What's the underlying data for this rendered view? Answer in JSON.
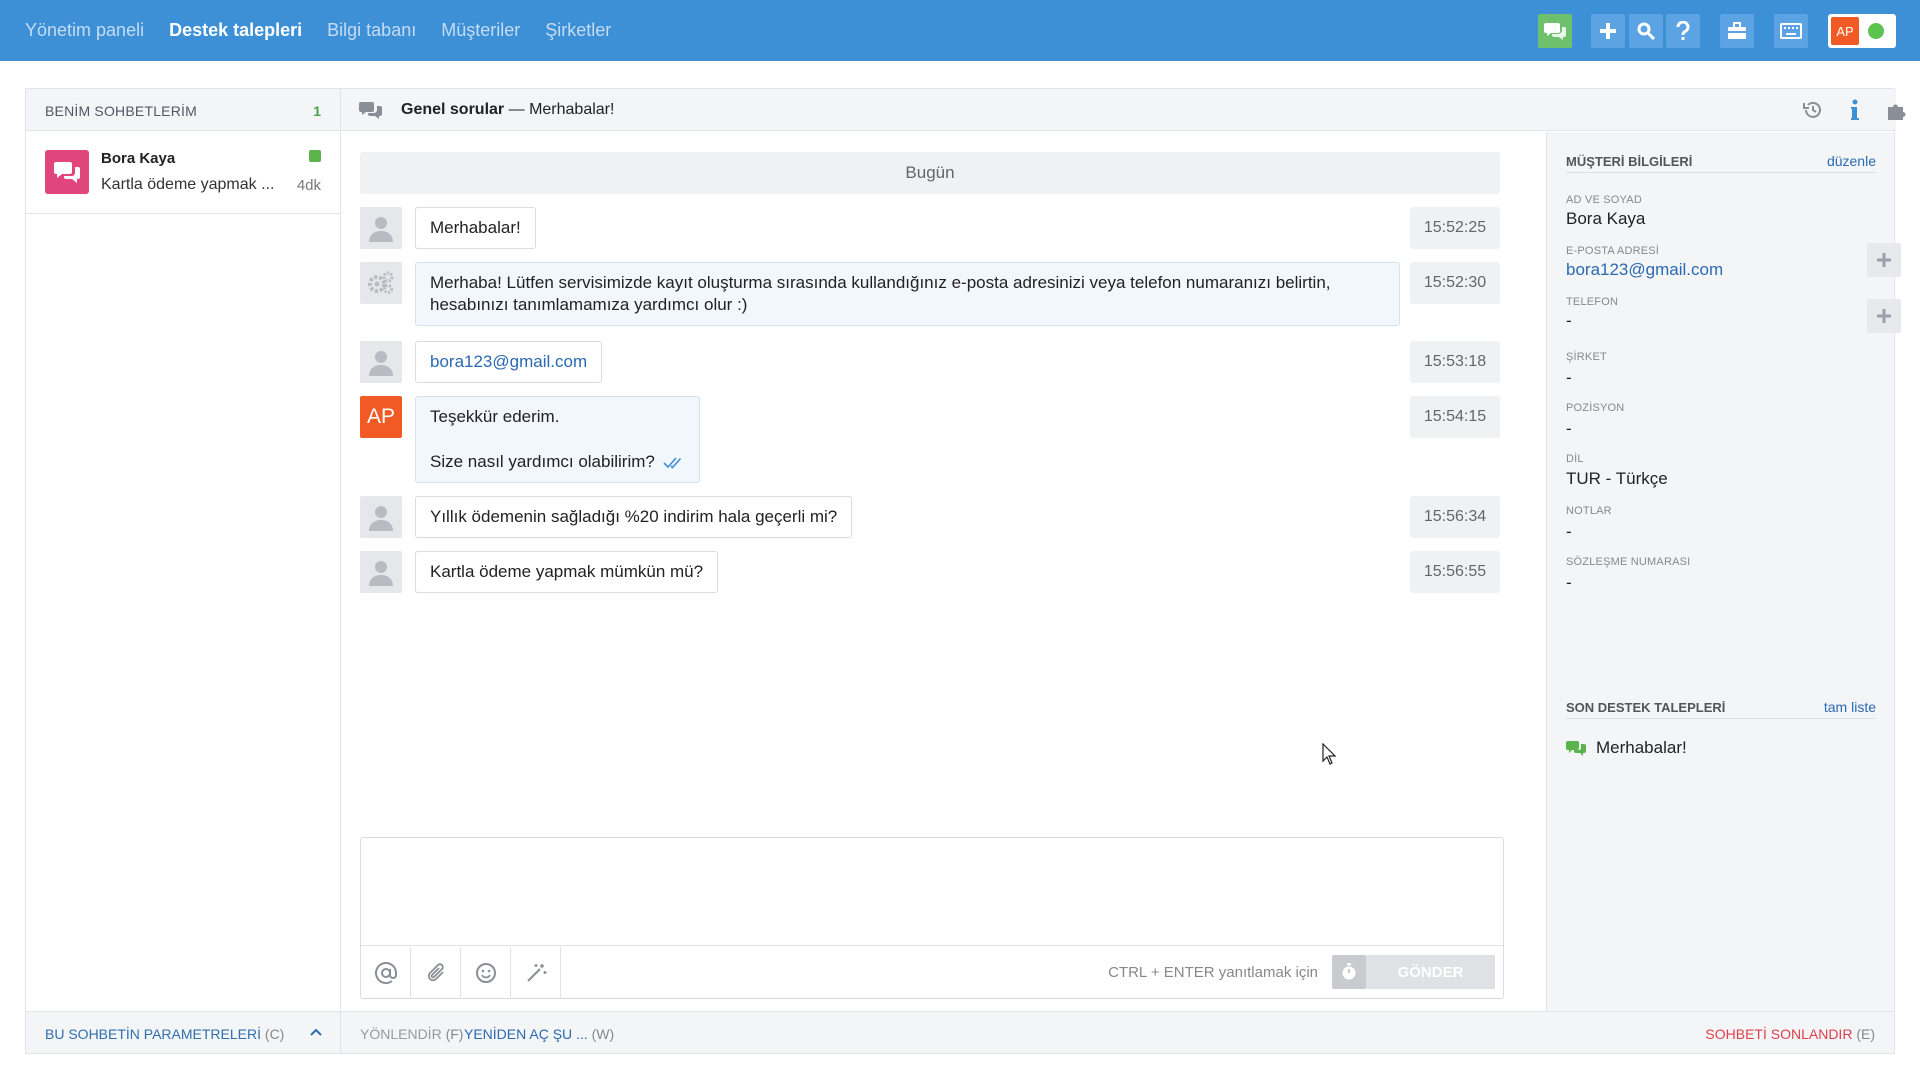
{
  "nav": {
    "items": [
      {
        "label": "Yönetim paneli",
        "active": false
      },
      {
        "label": "Destek talepleri",
        "active": true
      },
      {
        "label": "Bilgi tabanı",
        "active": false
      },
      {
        "label": "Müşteriler",
        "active": false
      },
      {
        "label": "Şirketler",
        "active": false
      }
    ]
  },
  "top_actions": [
    "chat-icon",
    "plus-icon",
    "search-icon",
    "help-icon",
    "briefcase-icon",
    "keyboard-icon"
  ],
  "user": {
    "initials": "AP",
    "status_color": "#5cc34e"
  },
  "colors": {
    "brand": "#3d8fd6",
    "operator_avatar": "#f15a24",
    "chat_avatar": "#e0457b",
    "link": "#2a69b3",
    "danger": "#e0404d"
  },
  "left_panel": {
    "title": "BENİM SOHBETLERİM",
    "count": "1",
    "chats": [
      {
        "name": "Bora Kaya",
        "preview": "Kartla ödeme yapmak ...",
        "age": "4dk"
      }
    ],
    "footer": {
      "label": "BU SOHBETİN PARAMETRELERİ",
      "shortcut": "(C)"
    }
  },
  "chat_header": {
    "category": "Genel sorular",
    "separator": "—",
    "subject": "Merhabalar!"
  },
  "day_separator": "Bugün",
  "messages": [
    {
      "author": "client",
      "text": "Merhabalar!",
      "time": "15:52:25"
    },
    {
      "author": "bot",
      "text": "Merhaba! Lütfen servisimizde kayıt oluşturma sırasında kullandığınız e-posta adresinizi veya telefon numaranızı belirtin, hesabınızı tanımlamamıza yardımcı olur :)",
      "time": "15:52:30"
    },
    {
      "author": "client",
      "text": "bora123@gmail.com",
      "time": "15:53:18"
    },
    {
      "author": "operator",
      "avatar": "AP",
      "line1": "Teşekkür ederim.",
      "line2": "Size nasıl yardımcı olabilirim?",
      "time": "15:54:15"
    },
    {
      "author": "client",
      "text": "Yıllık ödemenin sağladığı %20 indirim hala geçerli mi?",
      "time": "15:56:34"
    },
    {
      "author": "client",
      "text": "Kartla ödeme yapmak mümkün mü?",
      "time": "15:56:55"
    }
  ],
  "composer": {
    "tools": [
      "mention-icon",
      "attach-icon",
      "emoji-icon",
      "magic-wand-icon"
    ],
    "hint": "CTRL + ENTER yanıtlamak için",
    "send_label": "GÖNDER"
  },
  "center_footer": {
    "redirect": {
      "label": "YÖNLENDİR",
      "shortcut": "(F)"
    },
    "reopen": {
      "label": "YENİDEN AÇ ŞU ...",
      "shortcut": "(W)"
    },
    "end": {
      "label": "SOHBETİ SONLANDIR",
      "shortcut": "(E)"
    }
  },
  "customer": {
    "section_title": "MÜŞTERİ BİLGİLERİ",
    "edit_label": "düzenle",
    "fields": [
      {
        "label": "AD VE SOYAD",
        "value": "Bora Kaya"
      },
      {
        "label": "E-POSTA ADRESİ",
        "value": "bora123@gmail.com"
      },
      {
        "label": "TELEFON",
        "value": "-"
      },
      {
        "label": "ŞİRKET",
        "value": "-"
      },
      {
        "label": "POZİSYON",
        "value": "-"
      },
      {
        "label": "DİL",
        "value": "TUR - Türkçe"
      },
      {
        "label": "NOTLAR",
        "value": "-"
      },
      {
        "label": "SÖZLEŞME NUMARASI",
        "value": "-"
      }
    ]
  },
  "recent": {
    "section_title": "SON DESTEK TALEPLERİ",
    "full_list_label": "tam liste",
    "items": [
      {
        "label": "Merhabalar!"
      }
    ]
  }
}
